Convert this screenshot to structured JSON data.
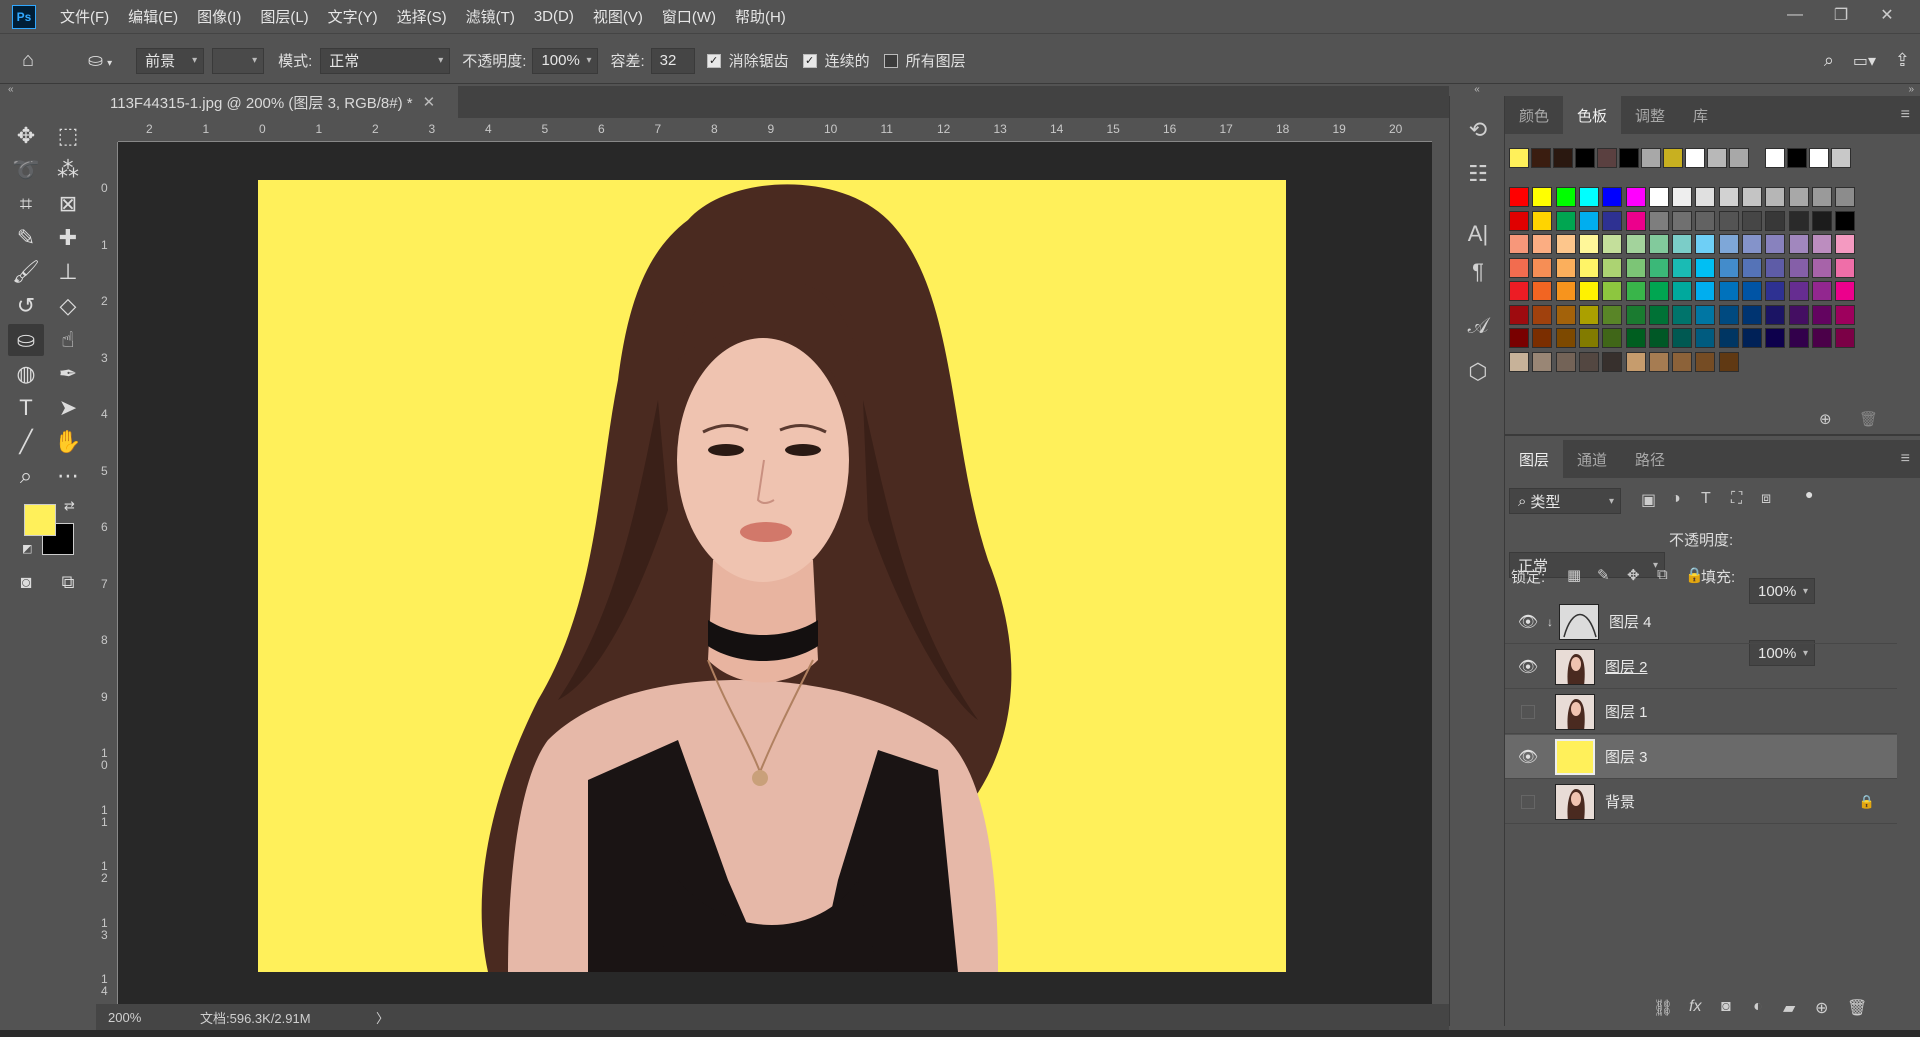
{
  "app": {
    "logo": "Ps"
  },
  "menubar": {
    "items": [
      "文件(F)",
      "编辑(E)",
      "图像(I)",
      "图层(L)",
      "文字(Y)",
      "选择(S)",
      "滤镜(T)",
      "3D(D)",
      "视图(V)",
      "窗口(W)",
      "帮助(H)"
    ],
    "window_controls": [
      "—",
      "❐",
      "✕"
    ]
  },
  "options": {
    "fill_source": "前景",
    "mode_label": "模式:",
    "mode_value": "正常",
    "opacity_label": "不透明度:",
    "opacity_value": "100%",
    "tolerance_label": "容差:",
    "tolerance_value": "32",
    "antialias_label": "消除锯齿",
    "antialias_checked": true,
    "contiguous_label": "连续的",
    "contiguous_checked": true,
    "all_layers_label": "所有图层",
    "all_layers_checked": false
  },
  "document": {
    "tab_title": "113F44315-1.jpg @ 200% (图层 3, RGB/8#) *",
    "close_glyph": "✕",
    "background_color": "#fff05a"
  },
  "rulers": {
    "h_labels": [
      "2",
      "1",
      "0",
      "1",
      "2",
      "3",
      "4",
      "5",
      "6",
      "7",
      "8",
      "9",
      "10",
      "11",
      "12",
      "13",
      "14",
      "15",
      "16",
      "17",
      "18",
      "19",
      "20"
    ],
    "v_labels": [
      "0",
      "1",
      "2",
      "3",
      "4",
      "5",
      "6",
      "7",
      "8",
      "9",
      "10",
      "11",
      "12",
      "13",
      "14"
    ]
  },
  "tools": {
    "foreground_color": "#fff05a",
    "background_color": "#000000",
    "active_tool": "paint-bucket-tool"
  },
  "status": {
    "zoom": "200%",
    "doc_size": "文档:596.3K/2.91M",
    "arrow": "〉"
  },
  "swatch_panel": {
    "tabs": [
      "颜色",
      "色板",
      "调整",
      "库"
    ],
    "active_tab": "色板",
    "recent": [
      "#fff05a",
      "#3a1d10",
      "#2a1810",
      "#000000",
      "#5a4040",
      "#000000",
      "#a8a8a8",
      "#c8b020",
      "#ffffff",
      "#b8b8b8",
      "#a8a8a8",
      "#ffffff",
      "#000000",
      "#ffffff",
      "#c8c8c8"
    ],
    "grid": [
      [
        "#ff0000",
        "#ffff00",
        "#00ff00",
        "#00ffff",
        "#0000ff",
        "#ff00ff",
        "#ffffff",
        "#eeeeee",
        "#e0e0e0",
        "#d2d2d2",
        "#c4c4c4",
        "#b6b6b6",
        "#a8a8a8",
        "#9a9a9a",
        "#8c8c8c"
      ],
      [
        "#e00000",
        "#ffd400",
        "#00a651",
        "#00aeef",
        "#2e3192",
        "#ec008c",
        "#7e7e7e",
        "#707070",
        "#626262",
        "#545454",
        "#464646",
        "#383838",
        "#2a2a2a",
        "#1c1c1c",
        "#000000"
      ],
      [
        "#f7977a",
        "#fbad82",
        "#fdc68c",
        "#fff799",
        "#c4df9b",
        "#a3d39c",
        "#82ca9c",
        "#7bcdc8",
        "#6ecff6",
        "#7ea7d8",
        "#8493ca",
        "#8882be",
        "#a187be",
        "#bc8dbf",
        "#f49ac1"
      ],
      [
        "#f26c4f",
        "#f68e55",
        "#fbaf5c",
        "#fff467",
        "#acd372",
        "#7cc576",
        "#3bb878",
        "#1abbb4",
        "#00bff3",
        "#438ccb",
        "#5573b7",
        "#5e5ca7",
        "#855fa8",
        "#a763a9",
        "#ef6ea8"
      ],
      [
        "#ed1c24",
        "#f26522",
        "#f7941d",
        "#fff200",
        "#8dc63f",
        "#39b54a",
        "#00a651",
        "#00a99d",
        "#00aeef",
        "#0072bc",
        "#0054a5",
        "#2e3192",
        "#662d91",
        "#92278f",
        "#ec008c"
      ],
      [
        "#9e0b0f",
        "#a0410d",
        "#a3620a",
        "#aba000",
        "#598527",
        "#1a7b30",
        "#007236",
        "#00746b",
        "#0076a3",
        "#004a80",
        "#003471",
        "#1b1464",
        "#440e62",
        "#630460",
        "#9e005d"
      ],
      [
        "#790000",
        "#7b2e00",
        "#7d4900",
        "#827b00",
        "#406618",
        "#005e20",
        "#005826",
        "#005952",
        "#005b7f",
        "#003663",
        "#002157",
        "#0d004c",
        "#32004b",
        "#4b0049",
        "#7b0046"
      ],
      [
        "#c7b299",
        "#998675",
        "#736357",
        "#534741",
        "#37302d",
        "#c69c6d",
        "#a67c52",
        "#8c6239",
        "#754c24",
        "#603913"
      ]
    ]
  },
  "layers_panel": {
    "tabs": [
      "图层",
      "通道",
      "路径"
    ],
    "active_tab": "图层",
    "filter_label": "类型",
    "blend_mode": "正常",
    "opacity_label": "不透明度:",
    "opacity_value": "100%",
    "lock_label": "锁定:",
    "fill_label": "填充:",
    "fill_value": "100%",
    "layers": [
      {
        "name": "图层 4",
        "visible": true,
        "selected": false,
        "thumb": "curve",
        "locked": false,
        "clipped": true
      },
      {
        "name": "图层 2",
        "visible": true,
        "selected": false,
        "thumb": "portrait",
        "locked": false,
        "clipped": false
      },
      {
        "name": "图层 1",
        "visible": false,
        "selected": false,
        "thumb": "portrait",
        "locked": false,
        "clipped": false
      },
      {
        "name": "图层 3",
        "visible": true,
        "selected": true,
        "thumb": "yellow",
        "locked": false,
        "clipped": false
      },
      {
        "name": "背景",
        "visible": false,
        "selected": false,
        "thumb": "portrait",
        "locked": true,
        "clipped": false
      }
    ],
    "bottom_icons": [
      "link-icon",
      "fx-icon",
      "mask-icon",
      "adjustment-icon",
      "folder-icon",
      "new-layer-icon",
      "trash-icon"
    ],
    "fx_label": "fx"
  }
}
